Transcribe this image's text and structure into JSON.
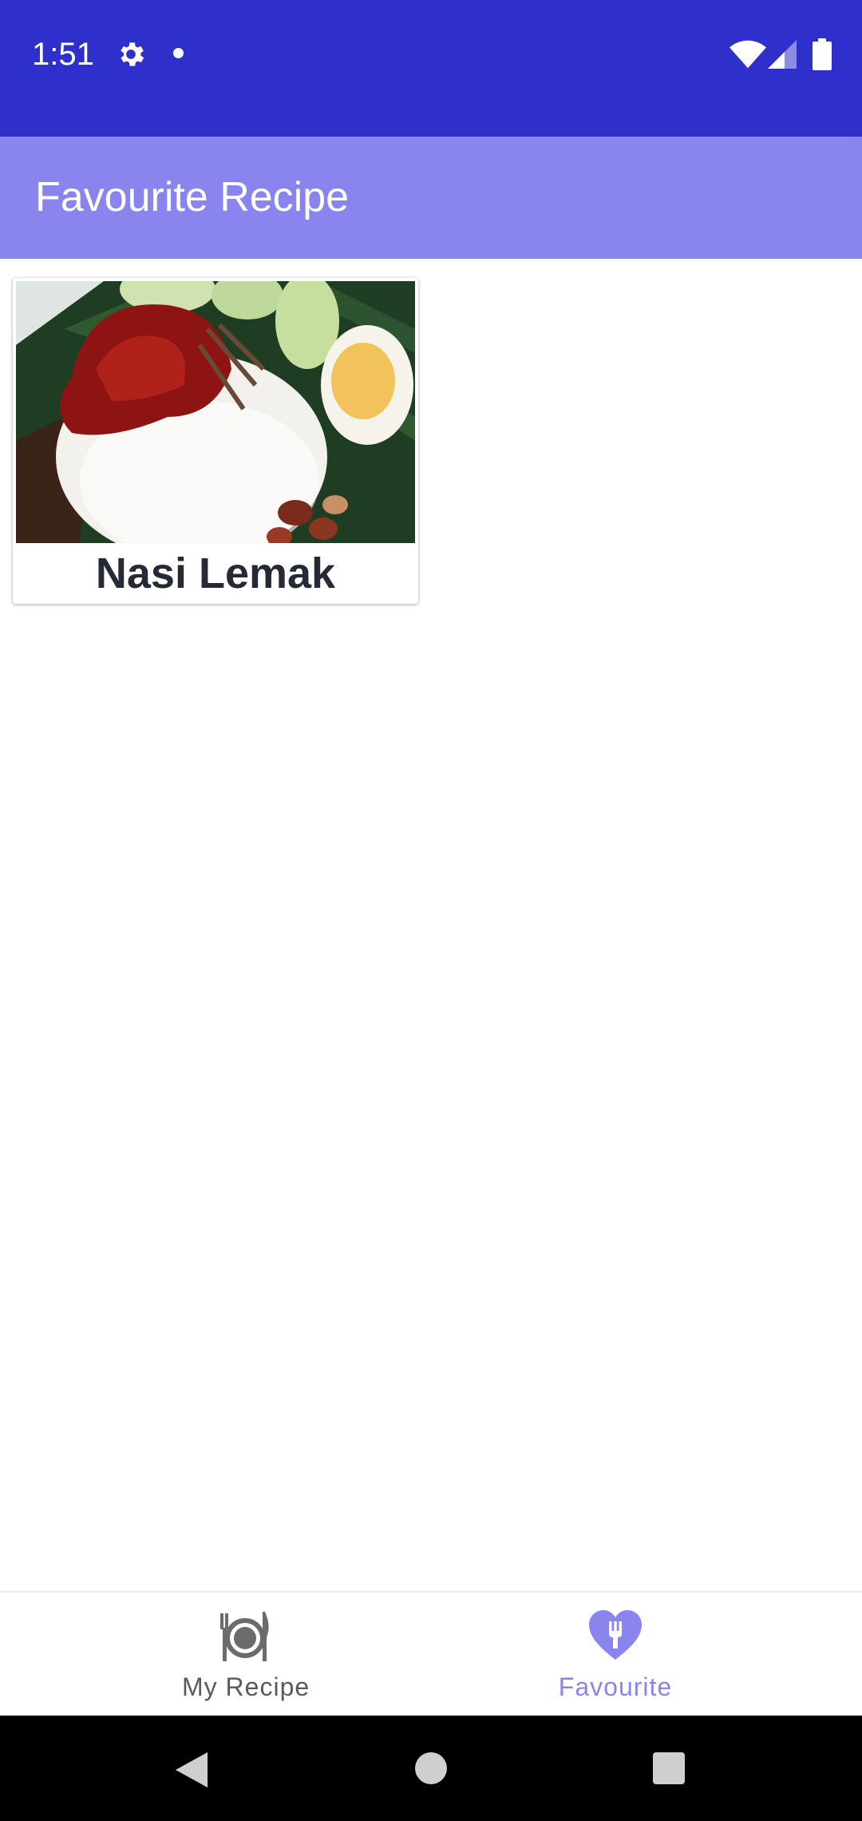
{
  "status_bar": {
    "time": "1:51",
    "icons": [
      "gear-icon",
      "notification-dot-icon",
      "wifi-icon",
      "signal-icon",
      "battery-icon"
    ],
    "background_color": "#2f2fcb"
  },
  "app_bar": {
    "title": "Favourite Recipe",
    "background_color": "#8a84ef"
  },
  "recipes": [
    {
      "title": "Nasi Lemak",
      "image": "nasi-lemak-photo"
    }
  ],
  "bottom_nav": {
    "items": [
      {
        "label": "My Recipe",
        "icon": "plate-cutlery-icon",
        "selected": false
      },
      {
        "label": "Favourite",
        "icon": "heart-fork-icon",
        "selected": true
      }
    ],
    "selected_color": "#8a84ef",
    "unselected_color": "#5a5a5a"
  },
  "system_nav": {
    "buttons": [
      "back-icon",
      "home-icon",
      "recents-icon"
    ]
  }
}
